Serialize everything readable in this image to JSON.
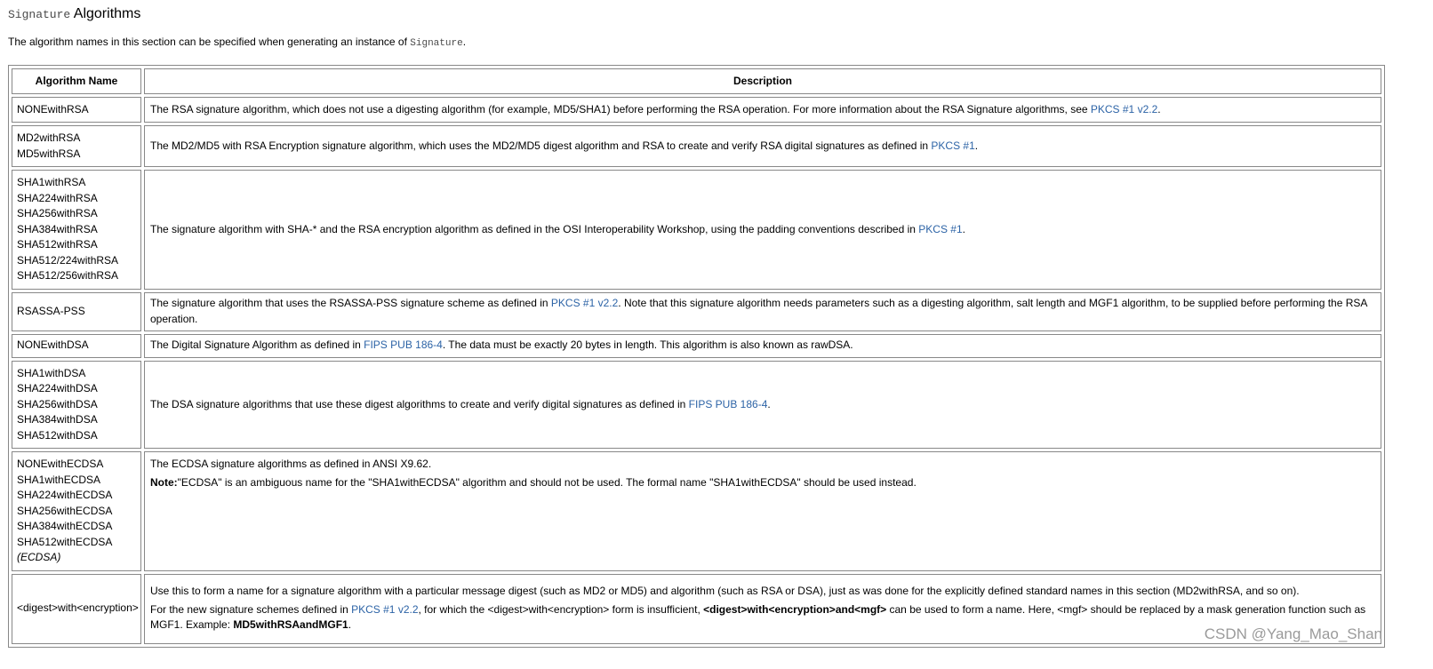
{
  "heading": {
    "code": "Signature",
    "text": " Algorithms"
  },
  "intro": {
    "text": "The algorithm names in this section can be specified when generating an instance of ",
    "code": "Signature",
    "end": "."
  },
  "table": {
    "header_name": "Algorithm Name",
    "header_desc": "Description",
    "rows": [
      {
        "names": [
          "NONEwithRSA"
        ],
        "d1": "The RSA signature algorithm, which does not use a digesting algorithm (for example, MD5/SHA1) before performing the RSA operation. For more information about the RSA Signature algorithms, see ",
        "link": "PKCS #1 v2.2",
        "d2": "."
      },
      {
        "names": [
          "MD2withRSA",
          "MD5withRSA"
        ],
        "d1": "The MD2/MD5 with RSA Encryption signature algorithm, which uses the MD2/MD5 digest algorithm and RSA to create and verify RSA digital signatures as defined in ",
        "link": "PKCS #1",
        "d2": "."
      },
      {
        "names": [
          "SHA1withRSA",
          "SHA224withRSA",
          "SHA256withRSA",
          "SHA384withRSA",
          "SHA512withRSA",
          "SHA512/224withRSA",
          "SHA512/256withRSA"
        ],
        "d1": "The signature algorithm with SHA-* and the RSA encryption algorithm as defined in the OSI Interoperability Workshop, using the padding conventions described in ",
        "link": "PKCS #1",
        "d2": "."
      },
      {
        "names": [
          "RSASSA-PSS"
        ],
        "d1": "The signature algorithm that uses the RSASSA-PSS signature scheme as defined in ",
        "link": "PKCS #1 v2.2",
        "d2": ". Note that this signature algorithm needs parameters such as a digesting algorithm, salt length and MGF1 algorithm, to be supplied before performing the RSA operation."
      },
      {
        "names": [
          "NONEwithDSA"
        ],
        "d1": "The Digital Signature Algorithm as defined in ",
        "link": "FIPS PUB 186-4",
        "d2": ". The data must be exactly 20 bytes in length. This algorithm is also known as rawDSA."
      },
      {
        "names": [
          "SHA1withDSA",
          "SHA224withDSA",
          "SHA256withDSA",
          "SHA384withDSA",
          "SHA512withDSA"
        ],
        "d1": "The DSA signature algorithms that use these digest algorithms to create and verify digital signatures as defined in ",
        "link": "FIPS PUB 186-4",
        "d2": "."
      }
    ],
    "ecdsa": {
      "names": [
        "NONEwithECDSA",
        "SHA1withECDSA",
        "SHA224withECDSA",
        "SHA256withECDSA",
        "SHA384withECDSA",
        "SHA512withECDSA"
      ],
      "alias": "(ECDSA)",
      "p1": "The ECDSA signature algorithms as defined in ANSI X9.62.",
      "note_label": "Note:",
      "note_text": "\"ECDSA\" is an ambiguous name for the \"SHA1withECDSA\" algorithm and should not be used. The formal name \"SHA1withECDSA\" should be used instead."
    },
    "generic": {
      "name": "<digest>with<encryption>",
      "p1": "Use this to form a name for a signature algorithm with a particular message digest (such as MD2 or MD5) and algorithm (such as RSA or DSA), just as was done for the explicitly defined standard names in this section (MD2withRSA, and so on).",
      "p2_a": "For the new signature schemes defined in ",
      "p2_link": "PKCS #1 v2.2",
      "p2_b": ", for which the <digest>with<encryption> form is insufficient, ",
      "p2_bold": "<digest>with<encryption>and<mgf>",
      "p2_c": " can be used to form a name. Here, <mgf> should be replaced by a mask generation function such as MGF1. Example: ",
      "p2_example": "MD5withRSAandMGF1",
      "p2_d": "."
    }
  },
  "watermark": "CSDN @Yang_Mao_Shan"
}
